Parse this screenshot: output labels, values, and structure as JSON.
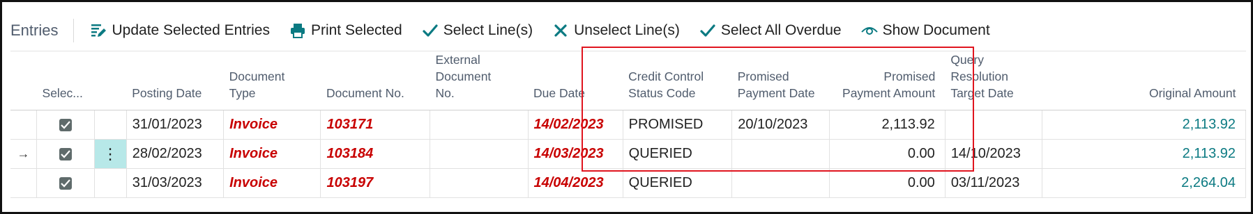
{
  "toolbar": {
    "title": "Entries",
    "actions": {
      "update": "Update Selected Entries",
      "print": "Print Selected",
      "select": "Select Line(s)",
      "unselect": "Unselect Line(s)",
      "select_overdue": "Select All Overdue",
      "show_document": "Show Document"
    }
  },
  "columns": {
    "selected": "Selec...",
    "posting_date": "Posting Date",
    "doc_type_1": "Document",
    "doc_type_2": "Type",
    "doc_no": "Document No.",
    "ext_1": "External",
    "ext_2": "Document",
    "ext_3": "No.",
    "due_date": "Due Date",
    "ccs_1": "Credit Control",
    "ccs_2": "Status Code",
    "ppd_1": "Promised",
    "ppd_2": "Payment Date",
    "ppa_1": "Promised",
    "ppa_2": "Payment Amount",
    "qr_1": "Query",
    "qr_2": "Resolution",
    "qr_3": "Target Date",
    "original_amount": "Original Amount"
  },
  "rows": [
    {
      "current": false,
      "posting_date": "31/01/2023",
      "doc_type": "Invoice",
      "doc_no": "103171",
      "ext_doc": "",
      "due_date": "14/02/2023",
      "status": "PROMISED",
      "promised_date": "20/10/2023",
      "promised_amount": "2,113.92",
      "query_date": "",
      "original_amount": "2,113.92"
    },
    {
      "current": true,
      "arrow": "→",
      "menu": "⋮",
      "posting_date": "28/02/2023",
      "doc_type": "Invoice",
      "doc_no": "103184",
      "ext_doc": "",
      "due_date": "14/03/2023",
      "status": "QUERIED",
      "promised_date": "",
      "promised_amount": "0.00",
      "query_date": "14/10/2023",
      "original_amount": "2,113.92"
    },
    {
      "current": false,
      "posting_date": "31/03/2023",
      "doc_type": "Invoice",
      "doc_no": "103197",
      "ext_doc": "",
      "due_date": "14/04/2023",
      "status": "QUERIED",
      "promised_date": "",
      "promised_amount": "0.00",
      "query_date": "03/11/2023",
      "original_amount": "2,264.04"
    }
  ],
  "colors": {
    "accent": "#0b7a82",
    "overdue": "#c80000",
    "highlight": "#e0141e"
  }
}
